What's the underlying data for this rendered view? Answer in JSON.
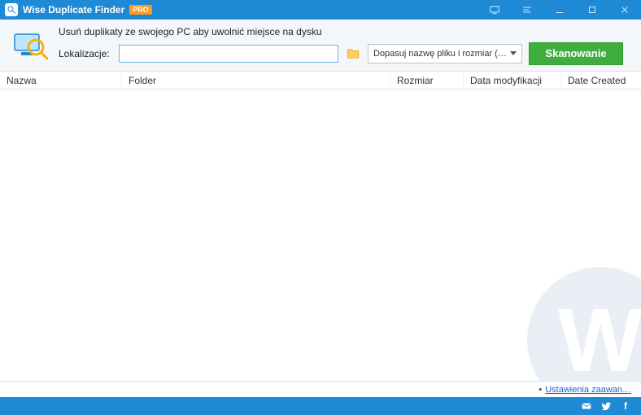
{
  "titlebar": {
    "app_name": "Wise Duplicate Finder",
    "pro_badge": "PRO"
  },
  "toolbar": {
    "headline": "Usuń duplikaty ze swojego PC aby uwolnić miejsce na dysku",
    "location_label": "Lokalizacje:",
    "location_value": "",
    "match_selected": "Dopasuj nazwę pliku i rozmiar (…",
    "scan_button": "Skanowanie"
  },
  "columns": {
    "name": "Nazwa",
    "folder": "Folder",
    "size": "Rozmiar",
    "modified": "Data modyfikacji",
    "created": "Date Created"
  },
  "watermark_letter": "W",
  "linkbar": {
    "advanced_link": "Ustawienia zaawan…"
  }
}
